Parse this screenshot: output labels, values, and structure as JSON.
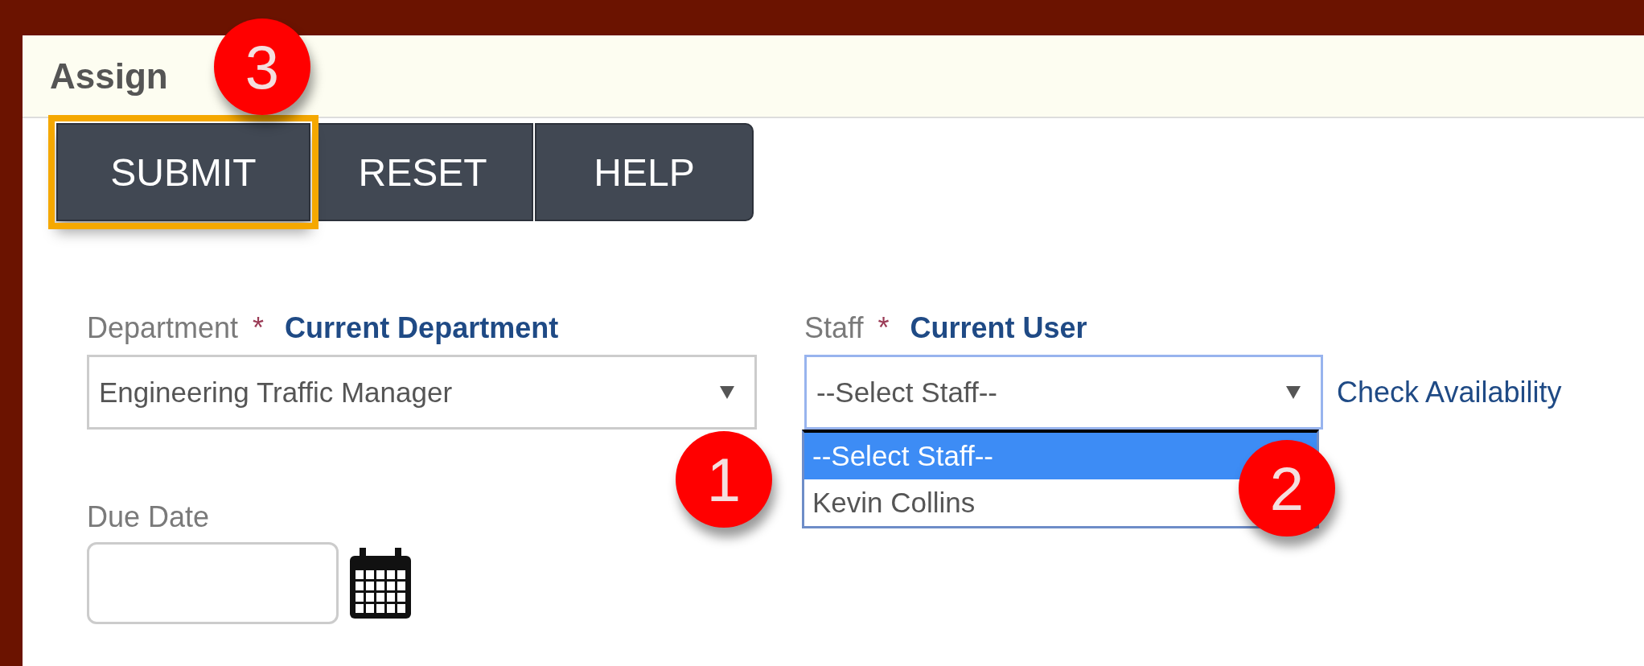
{
  "panel": {
    "title": "Assign"
  },
  "buttons": [
    {
      "label": "SUBMIT",
      "highlighted": true,
      "callout": "3"
    },
    {
      "label": "RESET",
      "highlighted": false
    },
    {
      "label": "HELP",
      "highlighted": false
    }
  ],
  "department": {
    "label": "Department",
    "required_mark": "*",
    "current_link": "Current Department",
    "value": "Engineering Traffic Manager",
    "callout": "1"
  },
  "staff": {
    "label": "Staff",
    "required_mark": "*",
    "current_link": "Current User",
    "value": "--Select Staff--",
    "expanded": true,
    "callout": "2",
    "side_link": "Check Availability",
    "options": [
      {
        "label": "--Select Staff--",
        "selected": true
      },
      {
        "label": "Kevin Collins",
        "selected": false
      }
    ]
  },
  "due_date": {
    "label": "Due Date"
  }
}
